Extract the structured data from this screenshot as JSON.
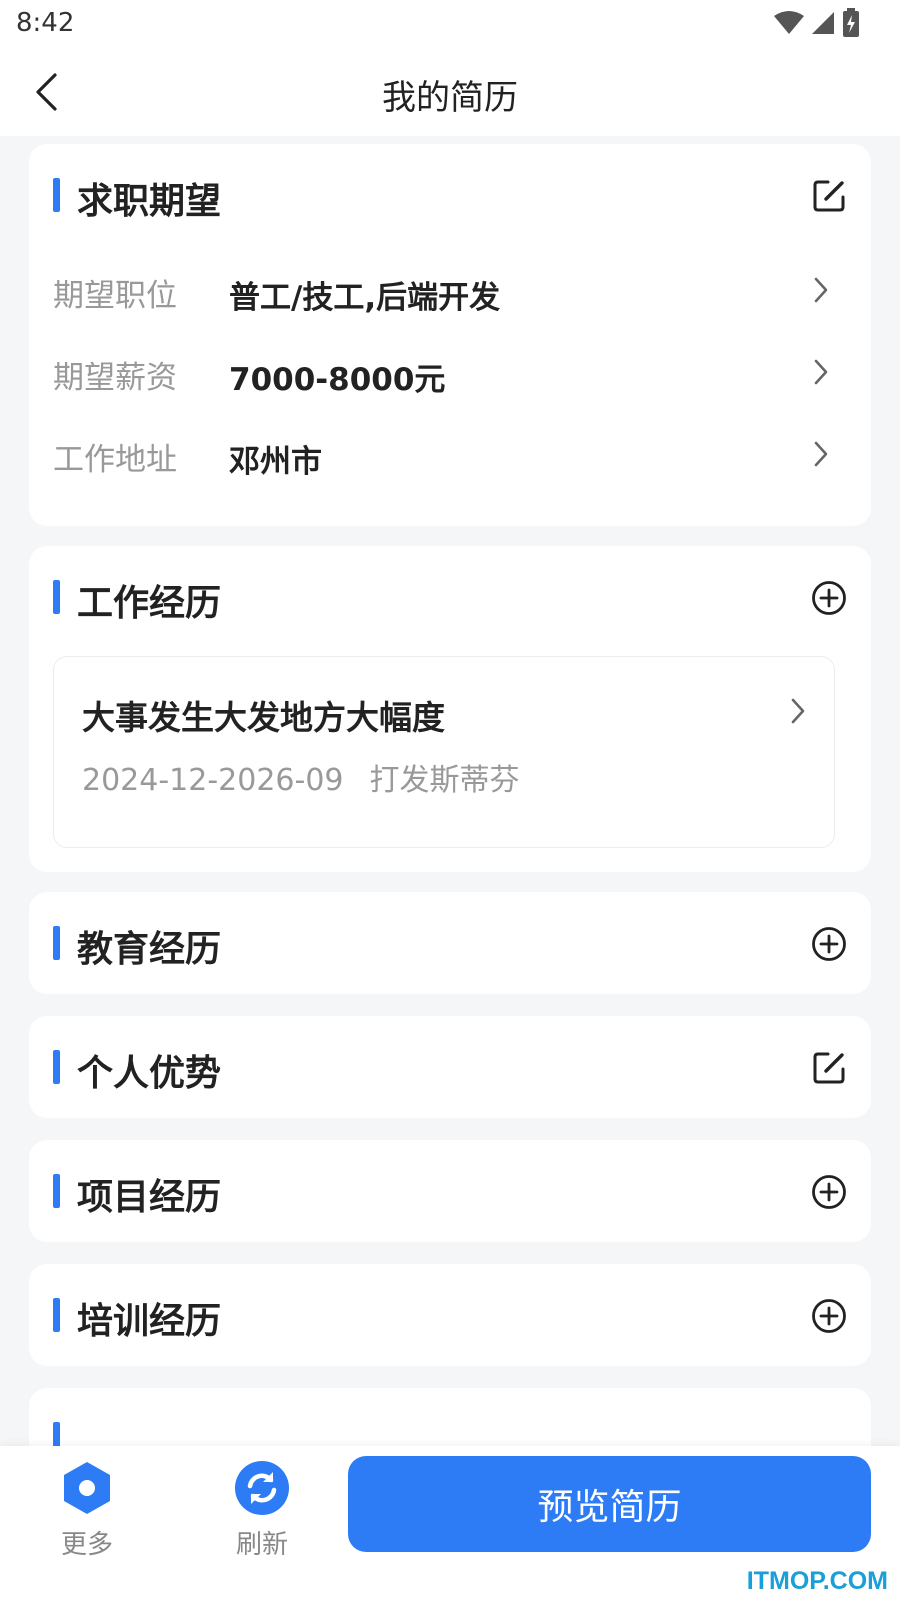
{
  "status": {
    "time": "8:42",
    "icons": [
      "wifi-icon",
      "signal-icon",
      "battery-charging-icon"
    ]
  },
  "header": {
    "title": "我的简历",
    "back_icon": "chevron-left-icon"
  },
  "sections": {
    "job_expectation": {
      "title": "求职期望",
      "action_icon": "edit-icon",
      "rows": [
        {
          "label": "期望职位",
          "value": "普工/技工,后端开发"
        },
        {
          "label": "期望薪资",
          "value": "7000-8000元"
        },
        {
          "label": "工作地址",
          "value": "邓州市"
        }
      ]
    },
    "work_experience": {
      "title": "工作经历",
      "action_icon": "add-circle-icon",
      "items": [
        {
          "company": "大事发生大发地方大幅度",
          "period": "2024-12-2026-09",
          "position": "打发斯蒂芬"
        }
      ]
    },
    "education": {
      "title": "教育经历",
      "action_icon": "add-circle-icon"
    },
    "advantages": {
      "title": "个人优势",
      "action_icon": "edit-icon"
    },
    "projects": {
      "title": "项目经历",
      "action_icon": "add-circle-icon"
    },
    "training": {
      "title": "培训经历",
      "action_icon": "add-circle-icon"
    }
  },
  "bottom": {
    "more_label": "更多",
    "refresh_label": "刷新",
    "preview_label": "预览简历"
  },
  "watermark": "ITMOP.COM",
  "colors": {
    "accent": "#2d7cf6",
    "background": "#f5f6f8",
    "card": "#ffffff",
    "label_gray": "#999999"
  }
}
